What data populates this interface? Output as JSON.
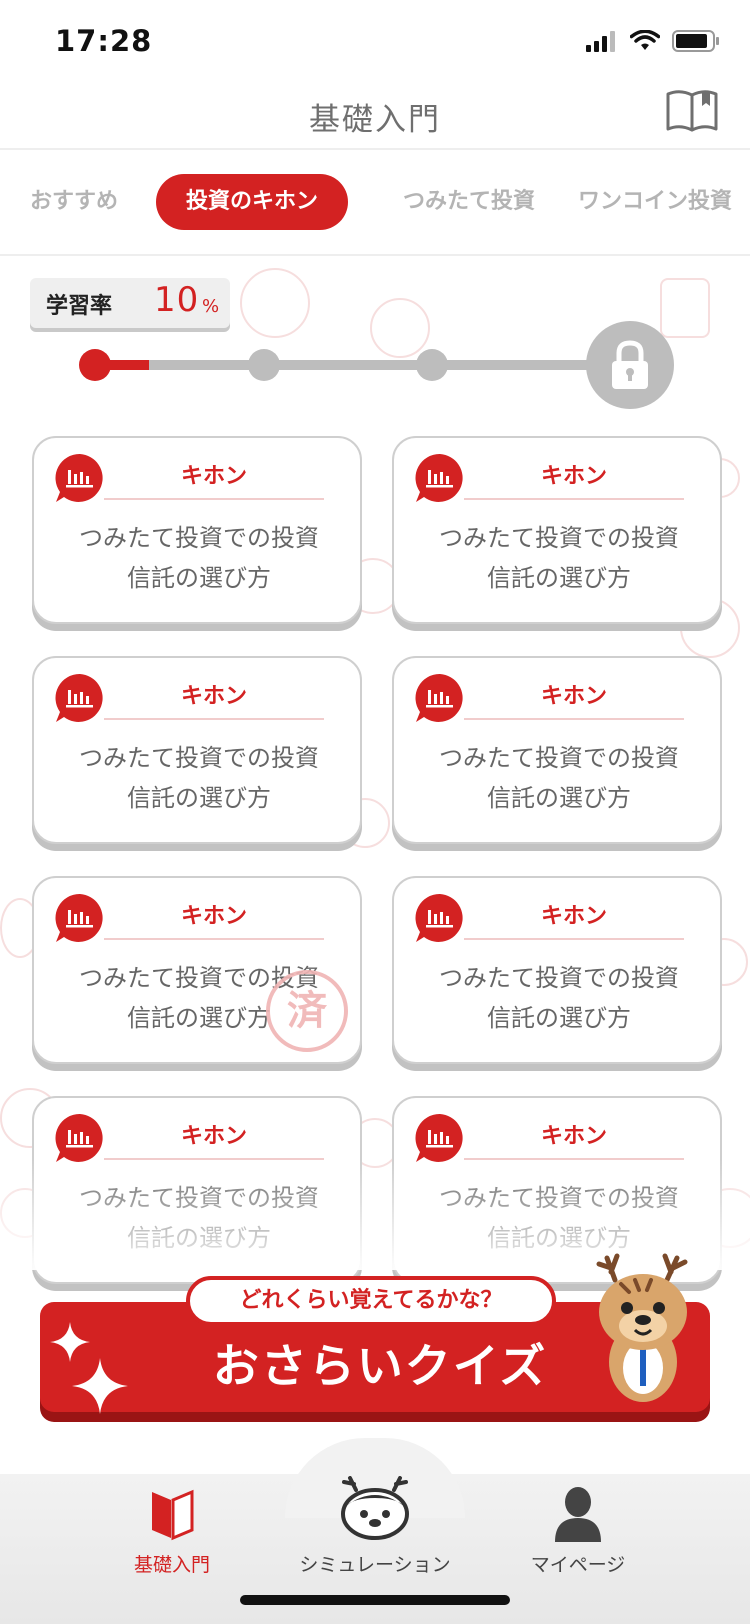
{
  "status_bar": {
    "time": "17:28"
  },
  "header": {
    "title": "基礎入門",
    "icon": "book-icon"
  },
  "tabs": [
    {
      "label": "おすすめ",
      "active": false
    },
    {
      "label": "投資のキホン",
      "active": true
    },
    {
      "label": "つみたて投資",
      "active": false
    },
    {
      "label": "ワンコイン投資",
      "active": false
    }
  ],
  "progress": {
    "label": "学習率",
    "value": "10",
    "unit": "%",
    "fraction": 0.1
  },
  "cards": [
    {
      "category": "キホン",
      "title_line1": "つみたて投資での投資",
      "title_line2": "信託の選び方",
      "completed": false
    },
    {
      "category": "キホン",
      "title_line1": "つみたて投資での投資",
      "title_line2": "信託の選び方",
      "completed": false
    },
    {
      "category": "キホン",
      "title_line1": "つみたて投資での投資",
      "title_line2": "信託の選び方",
      "completed": false
    },
    {
      "category": "キホン",
      "title_line1": "つみたて投資での投資",
      "title_line2": "信託の選び方",
      "completed": false
    },
    {
      "category": "キホン",
      "title_line1": "つみたて投資での投資",
      "title_line2": "信託の選び方",
      "completed": true,
      "stamp": "済"
    },
    {
      "category": "キホン",
      "title_line1": "つみたて投資での投資",
      "title_line2": "信託の選び方",
      "completed": false
    },
    {
      "category": "キホン",
      "title_line1": "つみたて投資での投資",
      "title_line2": "信託の選び方",
      "completed": false
    },
    {
      "category": "キホン",
      "title_line1": "つみたて投資での投資",
      "title_line2": "信託の選び方",
      "completed": false
    }
  ],
  "quiz": {
    "bubble": "どれくらい覚えてるかな？",
    "title": "おさらいクイズ"
  },
  "nav": [
    {
      "label": "基礎入門",
      "icon": "beginner-mark-icon",
      "active": true
    },
    {
      "label": "シミュレーション",
      "icon": "deer-face-icon",
      "active": false
    },
    {
      "label": "マイページ",
      "icon": "person-icon",
      "active": false
    }
  ],
  "colors": {
    "accent": "#d32222",
    "inactive": "#b4b4b4",
    "track": "#bdbdbd"
  }
}
